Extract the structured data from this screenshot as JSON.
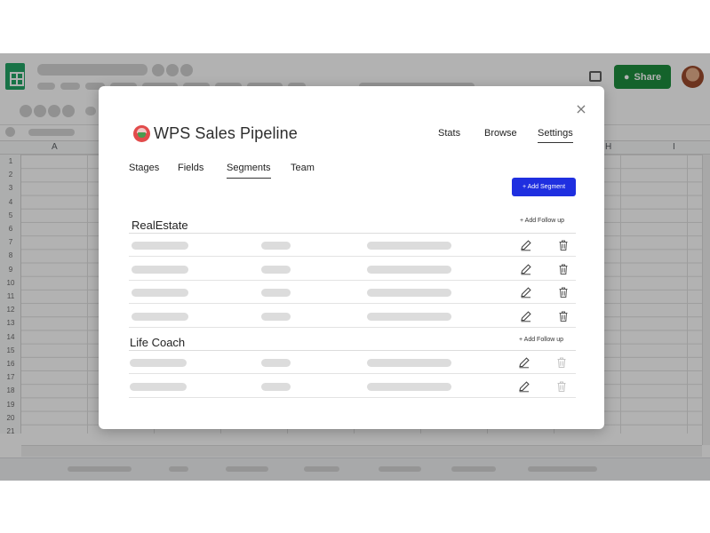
{
  "background_app": {
    "share_label": "Share",
    "column_headers": [
      "A",
      "H",
      "I"
    ],
    "row_numbers": [
      "1",
      "2",
      "3",
      "4",
      "5",
      "6",
      "7",
      "8",
      "9",
      "10",
      "11",
      "12",
      "13",
      "14",
      "15",
      "16",
      "17",
      "18",
      "19",
      "20",
      "21"
    ]
  },
  "modal": {
    "brand_title": "WPS Sales Pipeline",
    "close_glyph": "×",
    "top_nav": [
      {
        "label": "Stats",
        "active": false
      },
      {
        "label": "Browse",
        "active": false
      },
      {
        "label": "Settings",
        "active": true
      }
    ],
    "sub_nav": [
      {
        "label": "Stages",
        "active": false
      },
      {
        "label": "Fields",
        "active": false
      },
      {
        "label": "Segments",
        "active": true
      },
      {
        "label": "Team",
        "active": false
      }
    ],
    "add_segment_label": "+ Add Segment",
    "segments": [
      {
        "title": "RealEstate",
        "follow_up_label": "+ Add Follow up",
        "row_count": 4,
        "delete_enabled": true
      },
      {
        "title": "Life Coach",
        "follow_up_label": "+ Add Follow up",
        "row_count": 2,
        "delete_enabled": false
      }
    ]
  },
  "colors": {
    "accent_blue": "#1f2fe0",
    "share_green": "#1e8e3e",
    "placeholder_gray": "#dcdcdc",
    "overlay": "rgba(0,0,0,0.30)"
  },
  "icons": [
    "sheets-logo-icon",
    "chat-icon",
    "share-person-icon",
    "close-icon",
    "brand-logo-icon",
    "edit-icon",
    "trash-icon"
  ]
}
